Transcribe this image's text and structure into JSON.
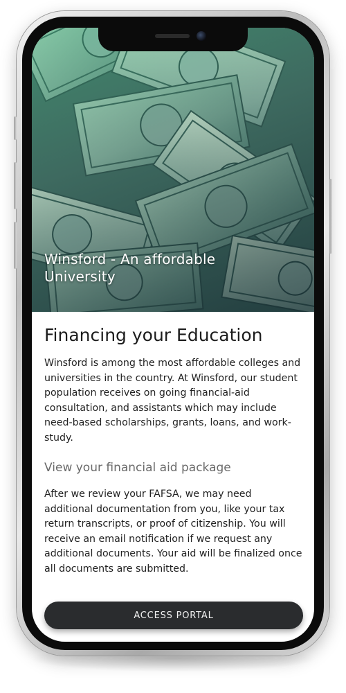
{
  "hero": {
    "title": "Winsford - An affordable University",
    "image": "money-bills-image"
  },
  "main": {
    "title": "Financing your Education",
    "intro": "Winsford is among the most affordable colleges and universities in the country. At Winsford, our student population receives on going financial-aid consultation, and assistants which may include need-based scholarships, grants, loans, and work-study.",
    "subheading": "View your financial aid package",
    "details": "After we review your FAFSA, we may need additional documentation from you, like your tax return transcripts, or proof of citizenship. You will receive an email notification if we request any additional documents. Your aid will be finalized once all documents are submitted."
  },
  "actions": {
    "portal_label": "ACCESS PORTAL"
  },
  "colors": {
    "button_bg": "#2a2c2e",
    "hero_tint": "#46c896"
  }
}
